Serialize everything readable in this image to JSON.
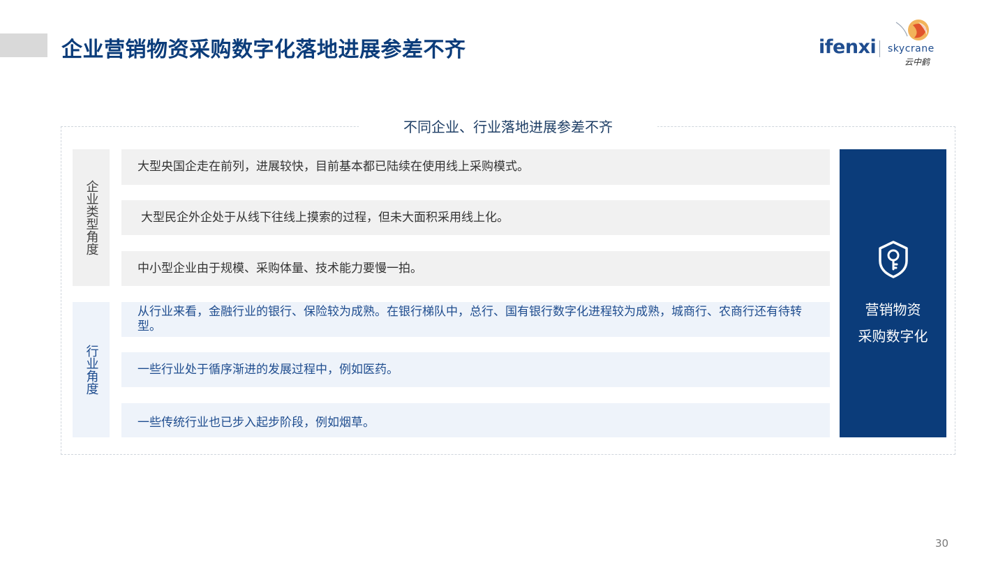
{
  "slide": {
    "title": "企业营销物资采购数字化落地进展参差不齐",
    "page_number": "30"
  },
  "logos": {
    "ifenxi": "ifenxi",
    "skycrane": "skycrane",
    "skycrane_cn": "云中鹤"
  },
  "frame": {
    "title": "不同企业、行业落地进展参差不齐"
  },
  "groups": [
    {
      "label": "企业类型角度",
      "items": [
        "大型央国企走在前列，进展较快，目前基本都已陆续在使用线上采购模式。",
        "大型民企外企处于从线下往线上摸索的过程，但未大面积采用线上化。",
        "中小型企业由于规模、采购体量、技术能力要慢一拍。"
      ]
    },
    {
      "label": "行业角度",
      "items": [
        "从行业来看，金融行业的银行、保险较为成熟。在银行梯队中，总行、国有银行数字化进程较为成熟，城商行、农商行还有待转型。",
        "一些行业处于循序渐进的发展过程中，例如医药。",
        "一些传统行业也已步入起步阶段，例如烟草。"
      ]
    }
  ],
  "side_panel": {
    "icon": "shield-key-icon",
    "line1": "营销物资",
    "line2": "采购数字化"
  },
  "colors": {
    "primary": "#0b3c7a",
    "accent_gray": "#d9d9d9",
    "row_gray": "#f1f1f1",
    "row_blue": "#eef3fa"
  }
}
